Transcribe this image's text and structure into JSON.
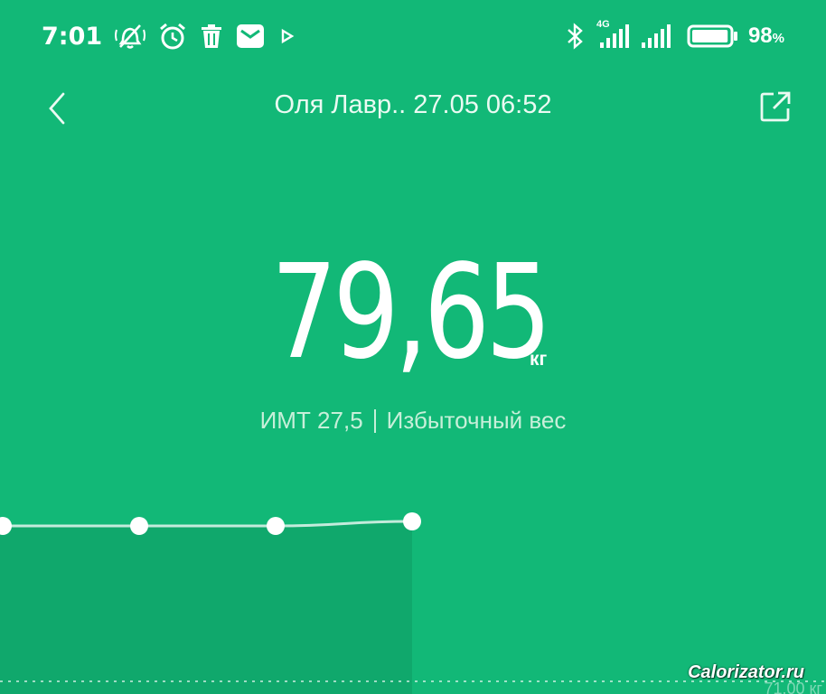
{
  "status_bar": {
    "time": "7:01",
    "network": "4G",
    "battery_percent": "98",
    "battery_unit": "%",
    "battery_level": 0.98,
    "icons": [
      "mute-icon",
      "alarm-icon",
      "trash-icon",
      "mail-icon",
      "play-icon",
      "bluetooth-icon",
      "signal-icon",
      "battery-icon"
    ]
  },
  "header": {
    "title": "Оля Лавр.. 27.05 06:52",
    "back_icon": "chevron-left-icon",
    "share_icon": "share-external-icon"
  },
  "measurement": {
    "weight": "79,65",
    "unit": "кг",
    "bmi": "ИМТ 27,5",
    "status": "Избыточный вес"
  },
  "chart_data": {
    "type": "line",
    "x": [
      0,
      1,
      2,
      3
    ],
    "series": [
      {
        "values": [
          79.4,
          79.4,
          79.4,
          79.65
        ]
      }
    ],
    "ylim": [
      71,
      80.5
    ],
    "axis_tick_visible": "71.00 кг",
    "grid": false
  },
  "watermark": "Calorizator.ru",
  "colors": {
    "background": "#12b877",
    "chart_fill": "#10a86c",
    "text": "#ffffff",
    "subtext": "#c7efd9"
  }
}
